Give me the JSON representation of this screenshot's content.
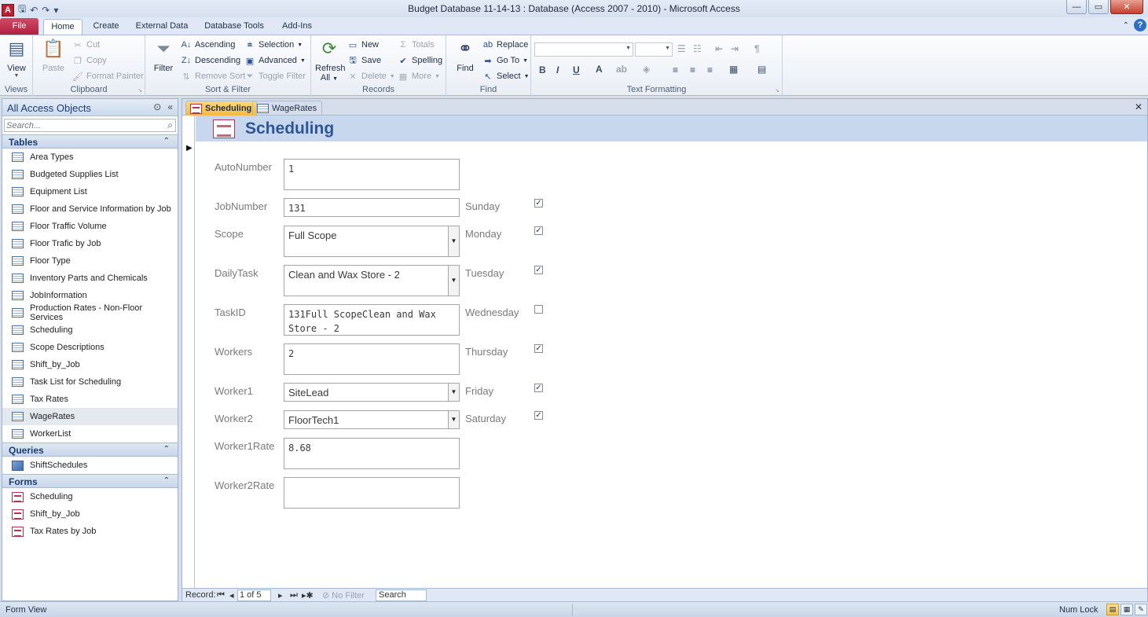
{
  "window": {
    "title": "Budget Database 11-14-13 : Database (Access 2007 - 2010)  -  Microsoft Access",
    "qat": {
      "save": "🖫",
      "undo": "↶",
      "redo": "↷",
      "customize": "▾"
    },
    "controls": {
      "minimize": "—",
      "maximize": "▭",
      "close": "✕"
    }
  },
  "ribbon": {
    "tabs": [
      "File",
      "Home",
      "Create",
      "External Data",
      "Database Tools",
      "Add-Ins"
    ],
    "active_tab": "Home",
    "groups": {
      "views": {
        "label": "Views",
        "view": "View"
      },
      "clipboard": {
        "label": "Clipboard",
        "paste": "Paste",
        "cut": "Cut",
        "copy": "Copy",
        "format_painter": "Format Painter"
      },
      "sort_filter": {
        "label": "Sort & Filter",
        "filter": "Filter",
        "ascending": "Ascending",
        "descending": "Descending",
        "remove_sort": "Remove Sort",
        "selection": "Selection",
        "advanced": "Advanced",
        "toggle_filter": "Toggle Filter"
      },
      "records": {
        "label": "Records",
        "refresh": "Refresh",
        "refresh_sub": "All",
        "new": "New",
        "save": "Save",
        "delete": "Delete",
        "totals": "Totals",
        "spelling": "Spelling",
        "more": "More"
      },
      "find": {
        "label": "Find",
        "find": "Find",
        "replace": "Replace",
        "go_to": "Go To",
        "select": "Select"
      },
      "text_formatting": {
        "label": "Text Formatting",
        "bold": "B",
        "italic": "I",
        "underline": "U",
        "font_color": "A"
      }
    }
  },
  "nav_pane": {
    "title": "All Access Objects",
    "search_placeholder": "Search...",
    "sections": [
      {
        "title": "Tables",
        "type": "table",
        "items": [
          "Area Types",
          "Budgeted Supplies List",
          "Equipment List",
          "Floor and Service Information by Job",
          "Floor Traffic Volume",
          "Floor Trafic by Job",
          "Floor Type",
          "Inventory Parts and Chemicals",
          "JobInformation",
          "Production Rates - Non-Floor Services",
          "Scheduling",
          "Scope Descriptions",
          "Shift_by_Job",
          "Task List for Scheduling",
          "Tax Rates",
          "WageRates",
          "WorkerList"
        ],
        "selected": "WageRates"
      },
      {
        "title": "Queries",
        "type": "query",
        "items": [
          "ShiftSchedules"
        ]
      },
      {
        "title": "Forms",
        "type": "form",
        "items": [
          "Scheduling",
          "Shift_by_Job",
          "Tax Rates by Job"
        ]
      }
    ]
  },
  "doc_tabs": [
    {
      "label": "Scheduling",
      "active": true,
      "kind": "form"
    },
    {
      "label": "WageRates",
      "active": false,
      "kind": "table"
    }
  ],
  "form": {
    "title": "Scheduling",
    "fields": [
      {
        "label": "AutoNumber",
        "value": "1",
        "kind": "text"
      },
      {
        "label": "JobNumber",
        "value": "131",
        "kind": "text"
      },
      {
        "label": "Scope",
        "value": "Full Scope",
        "kind": "combo"
      },
      {
        "label": "DailyTask",
        "value": "Clean and Wax Store - 2",
        "kind": "combo"
      },
      {
        "label": "TaskID",
        "value": "131Full ScopeClean and Wax Store - 2",
        "kind": "text"
      },
      {
        "label": "Workers",
        "value": "2",
        "kind": "text"
      },
      {
        "label": "Worker1",
        "value": "SiteLead",
        "kind": "combo"
      },
      {
        "label": "Worker2",
        "value": "FloorTech1",
        "kind": "combo"
      },
      {
        "label": "Worker1Rate",
        "value": "8.68",
        "kind": "text"
      },
      {
        "label": "Worker2Rate",
        "value": "",
        "kind": "text"
      }
    ],
    "days": [
      {
        "label": "Sunday",
        "checked": true
      },
      {
        "label": "Monday",
        "checked": true
      },
      {
        "label": "Tuesday",
        "checked": true
      },
      {
        "label": "Wednesday",
        "checked": false
      },
      {
        "label": "Thursday",
        "checked": true
      },
      {
        "label": "Friday",
        "checked": true
      },
      {
        "label": "Saturday",
        "checked": true
      }
    ]
  },
  "record_nav": {
    "label": "Record:",
    "current": "1 of 5",
    "filter": "No Filter",
    "search": "Search"
  },
  "status": {
    "view": "Form View",
    "num_lock": "Num Lock"
  },
  "colors": {
    "accent": "#2f5597",
    "file_tab": "#b0203f",
    "active_doc_tab": "#f8b844"
  }
}
